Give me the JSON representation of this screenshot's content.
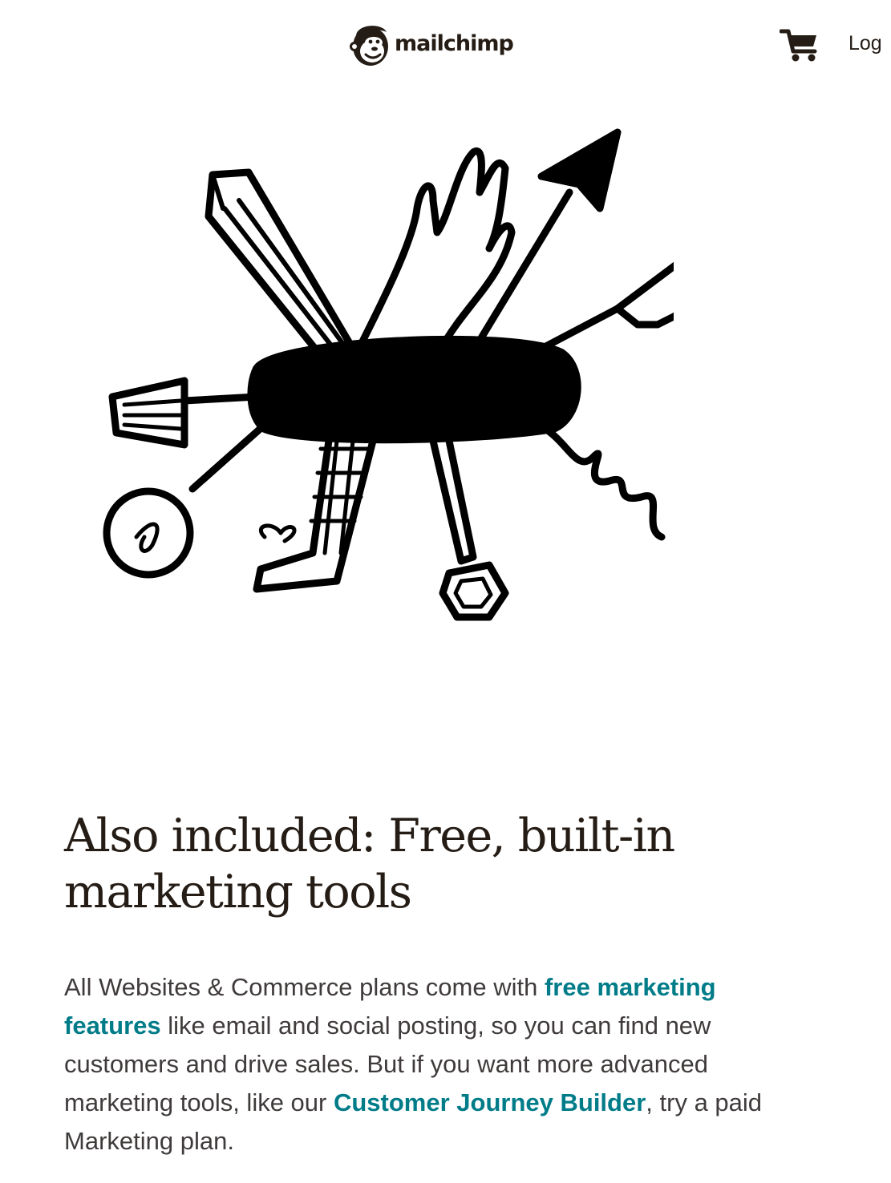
{
  "header": {
    "brand": "mailchimp",
    "cart_icon": "shopping-cart-icon",
    "login_label": "Log"
  },
  "hero": {
    "illustration": "swiss-army-knife-marketing-tools-illustration"
  },
  "section": {
    "headline_line1": "Also included: Free, built-in",
    "headline_line2": "marketing tools",
    "body_part1": "All Websites & Commerce plans come with ",
    "link1": "free marketing features",
    "body_part2": " like email and social posting, so you can find new customers and drive sales. But if you want more advanced marketing tools, like our ",
    "link2": "Customer Journey Builder",
    "body_part3": ", try a paid Marketing plan."
  },
  "colors": {
    "text": "#241c15",
    "body_text": "#403b3b",
    "link": "#007c89",
    "background": "#ffffff"
  }
}
